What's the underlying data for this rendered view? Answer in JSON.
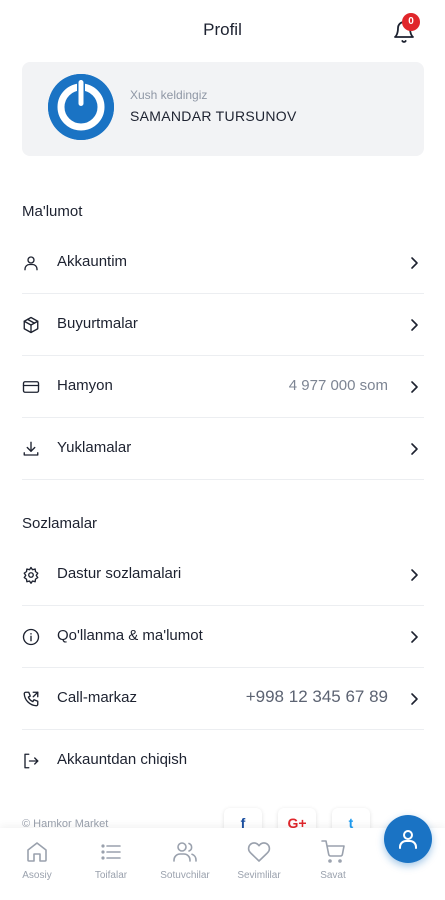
{
  "header": {
    "title": "Profil",
    "notifications_count": "0"
  },
  "profile": {
    "greeting": "Xush keldingiz",
    "name": "SAMANDAR TURSUNOV"
  },
  "sections": {
    "info_title": "Ma'lumot",
    "settings_title": "Sozlamalar"
  },
  "info_items": [
    {
      "label": "Akkauntim",
      "icon": "user-icon"
    },
    {
      "label": "Buyurtmalar",
      "icon": "box-icon"
    },
    {
      "label": "Hamyon",
      "icon": "wallet-icon",
      "value": "4 977 000 som"
    },
    {
      "label": "Yuklamalar",
      "icon": "download-icon"
    }
  ],
  "settings_items": [
    {
      "label": "Dastur sozlamalari",
      "icon": "gear-icon"
    },
    {
      "label": "Qo'llanma & ma'lumot",
      "icon": "info-icon"
    },
    {
      "label": "Call-markaz",
      "icon": "phone-icon",
      "value": "+998 12 345 67 89"
    },
    {
      "label": "Akkauntdan chiqish",
      "icon": "logout-icon"
    }
  ],
  "footer": {
    "copyright": "© Hamkor Market"
  },
  "social": [
    "facebook-icon",
    "google-plus-icon",
    "twitter-icon"
  ],
  "bottom_nav": [
    {
      "label": "Asosiy",
      "icon": "home-icon"
    },
    {
      "label": "Toifalar",
      "icon": "list-icon"
    },
    {
      "label": "Sotuvchilar",
      "icon": "users-icon"
    },
    {
      "label": "Sevimlilar",
      "icon": "heart-icon"
    },
    {
      "label": "Savat",
      "icon": "cart-icon"
    }
  ],
  "colors": {
    "accent": "#1a73c4",
    "badge": "#e0262b",
    "text": "#1d2230",
    "muted": "#9aa1ad"
  }
}
